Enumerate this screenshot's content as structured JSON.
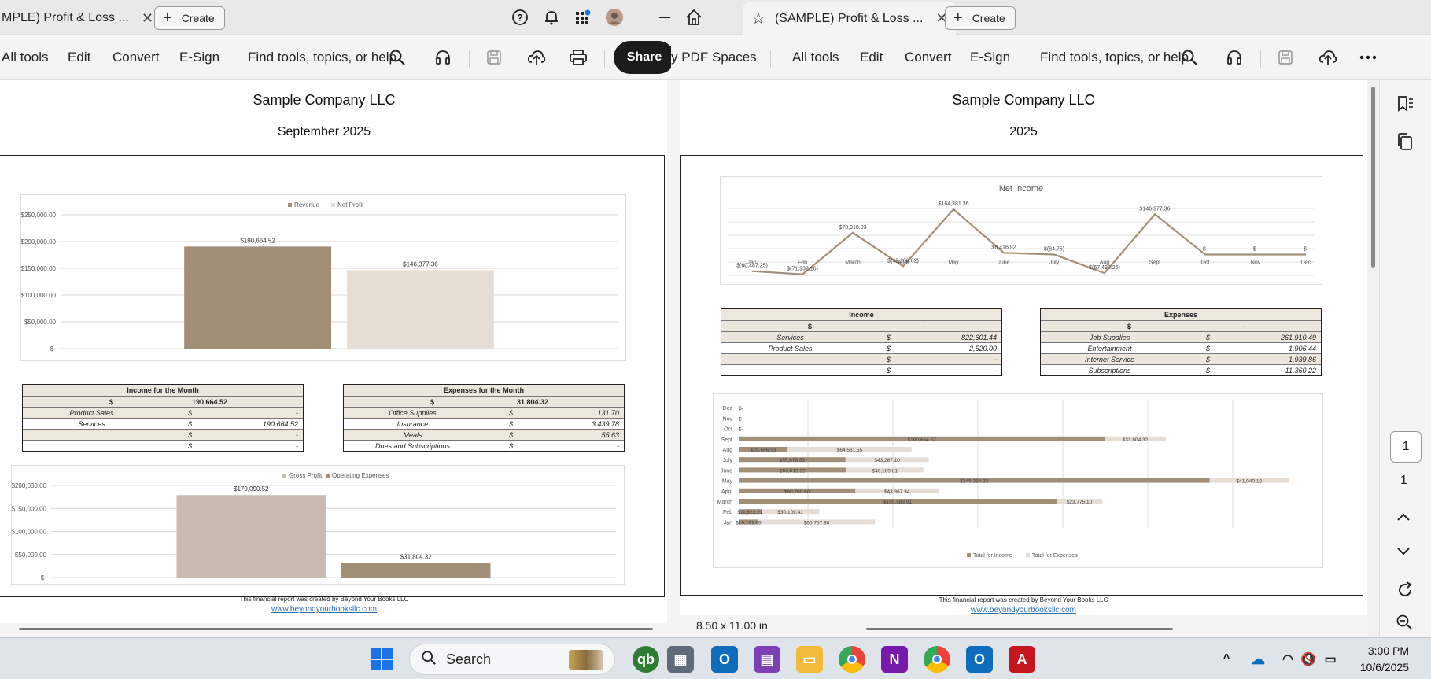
{
  "left_window": {
    "tab_title": "MPLE) Profit & Loss ...",
    "create_label": "Create",
    "menu": [
      "All tools",
      "Edit",
      "Convert",
      "E-Sign"
    ],
    "search_text": "Find tools, topics, or help",
    "share_label": "Share",
    "partial_tab": "nu",
    "page": {
      "company": "Sample Company LLC",
      "period": "September 2025",
      "chart1": {
        "legend": [
          "Revenue",
          "Net Profit"
        ],
        "yticks": [
          "$250,000.00",
          "$200,000.00",
          "$150,000.00",
          "$100,000.00",
          "$50,000.00",
          "$-"
        ]
      },
      "income_table": {
        "title": "Income for the Month",
        "total_currency": "$",
        "total": "190,664.52",
        "rows": [
          {
            "label": "Product Sales",
            "cur": "$",
            "value": "-"
          },
          {
            "label": "Services",
            "cur": "$",
            "value": "190,664.52"
          },
          {
            "label": "",
            "cur": "$",
            "value": "-"
          },
          {
            "label": "",
            "cur": "$",
            "value": "-"
          }
        ]
      },
      "expense_table": {
        "title": "Expenses for the Month",
        "total_currency": "$",
        "total": "31,804.32",
        "rows": [
          {
            "label": "Office Supplies",
            "cur": "$",
            "value": "131.70"
          },
          {
            "label": "Insurance",
            "cur": "$",
            "value": "3,439.78"
          },
          {
            "label": "Meals",
            "cur": "$",
            "value": "55.63"
          },
          {
            "label": "Dues and Subscriptions",
            "cur": "$",
            "value": "-"
          }
        ]
      },
      "chart2": {
        "legend": [
          "Gross Profit",
          "Operating Expenses"
        ],
        "yticks": [
          "$200,000.00",
          "$150,000.00",
          "$100,000.00",
          "$50,000.00",
          "$-"
        ]
      },
      "footer_text": "This financial report was created by Beyond Your Books LLC",
      "footer_link": "www.beyondyourbooksllc.com"
    }
  },
  "right_window": {
    "tab_title": "(SAMPLE) Profit & Loss ...",
    "create_label": "Create",
    "spaces_label": "y PDF Spaces",
    "menu": [
      "All tools",
      "Edit",
      "Convert",
      "E-Sign"
    ],
    "search_text": "Find tools, topics, or help",
    "page": {
      "company": "Sample Company LLC",
      "period": "2025",
      "net_income_title": "Net Income",
      "income_table": {
        "title": "Income",
        "total_currency": "$",
        "total": "-",
        "rows": [
          {
            "label": "Services",
            "cur": "$",
            "value": "822,601.44"
          },
          {
            "label": "Product Sales",
            "cur": "$",
            "value": "2,520.00"
          },
          {
            "label": "",
            "cur": "$",
            "value": "-"
          },
          {
            "label": "",
            "cur": "$",
            "value": "-"
          }
        ]
      },
      "expense_table": {
        "title": "Expenses",
        "total_currency": "$",
        "total": "-",
        "rows": [
          {
            "label": "Job Supplies",
            "cur": "$",
            "value": "261,910.49"
          },
          {
            "label": "Entertainment",
            "cur": "$",
            "value": "1,906.44"
          },
          {
            "label": "Internet Service",
            "cur": "$",
            "value": "1,939.86"
          },
          {
            "label": "Subscriptions",
            "cur": "$",
            "value": "11,360.22"
          }
        ]
      },
      "bar_legend": [
        "Total for Income",
        "Total for Expenses"
      ],
      "footer_text": "This financial report was created by Beyond Your Books LLC",
      "footer_link": "www.beyondyourbooksllc.com"
    },
    "page_size": "8.50 x 11.00 in",
    "page_number": "1",
    "page_total": "1"
  },
  "taskbar": {
    "search_placeholder": "Search",
    "time": "3:00 PM",
    "date": "10/6/2025"
  },
  "colors": {
    "revenue": "#a38f78",
    "net_profit": "#e6ddd5",
    "gross_profit": "#c7bcaf",
    "operating_expenses": "#a38f78",
    "table_fill": "#ece6dc"
  },
  "chart_data": [
    {
      "type": "bar",
      "categories": [
        "Revenue",
        "Net Profit"
      ],
      "values": [
        190664.52,
        146377.36
      ],
      "data_labels": [
        "$190,664.52",
        "$146,377.36"
      ],
      "legend": [
        "Revenue",
        "Net Profit"
      ],
      "ylim": [
        0,
        250000
      ],
      "grid": true,
      "legend_position": "top"
    },
    {
      "type": "bar",
      "categories": [
        "Gross Profit",
        "Operating Expenses"
      ],
      "values": [
        179090.52,
        31804.32
      ],
      "data_labels": [
        "$179,090.52",
        "$31,804.32"
      ],
      "legend": [
        "Gross Profit",
        "Operating Expenses"
      ],
      "ylim": [
        0,
        200000
      ],
      "grid": true,
      "legend_position": "top"
    },
    {
      "type": "line",
      "title": "Net Income",
      "categories": [
        "Jan",
        "Feb",
        "March",
        "April",
        "May",
        "June",
        "July",
        "Aug",
        "Sept",
        "Oct",
        "Nov",
        "Dec"
      ],
      "values": [
        -60487.25,
        -71932.16,
        78918.03,
        -42206.02,
        164381.36,
        6416.92,
        -84.75,
        -67490.26,
        146377.36,
        0,
        0,
        0
      ],
      "data_labels": [
        "$(60,487.25)",
        "$(71,932.16)",
        "$78,918.03",
        "$(42,206.02)",
        "$164,381.36",
        "$6,416.92",
        "$(84.75)",
        "$(67,490.26)",
        "$146,377.36",
        "$-",
        "$-",
        "$-"
      ],
      "grid": true
    },
    {
      "type": "bar",
      "orientation": "horizontal",
      "categories": [
        "Jan",
        "Feb",
        "March",
        "April",
        "May",
        "June",
        "July",
        "Aug",
        "Sept",
        "Oct",
        "Nov",
        "Dec"
      ],
      "series": [
        {
          "name": "Total for Income",
          "values": [
            10181.06,
            11822.21,
            165583.91,
            60760.6,
            245385.32,
            56012.22,
            55678.53,
            25506.53,
            190664.52,
            0,
            0,
            0
          ]
        },
        {
          "name": "Total for Expenses",
          "values": [
            60757.88,
            30109.41,
            23775.1,
            43367.34,
            41040.19,
            40189.81,
            43287.1,
            64561.55,
            31804.32,
            0,
            0,
            0
          ]
        }
      ],
      "income_labels": [
        "$10,181.06",
        "$11,822.21",
        "$165,583.91",
        "$60,760.60",
        "$245,385.32",
        "$56,012.22",
        "$55,678.53",
        "$25,506.53",
        "$190,664.52",
        "$-",
        "$-",
        "$-"
      ],
      "expense_labels": [
        "$60,757.88",
        "$30,109.41",
        "$23,775.10",
        "$43,367.34",
        "$41,040.19",
        "$40,189.81",
        "$43,287.10",
        "$64,561.55",
        "$31,804.32",
        "",
        "",
        ""
      ],
      "legend_position": "bottom",
      "grid": true
    }
  ]
}
